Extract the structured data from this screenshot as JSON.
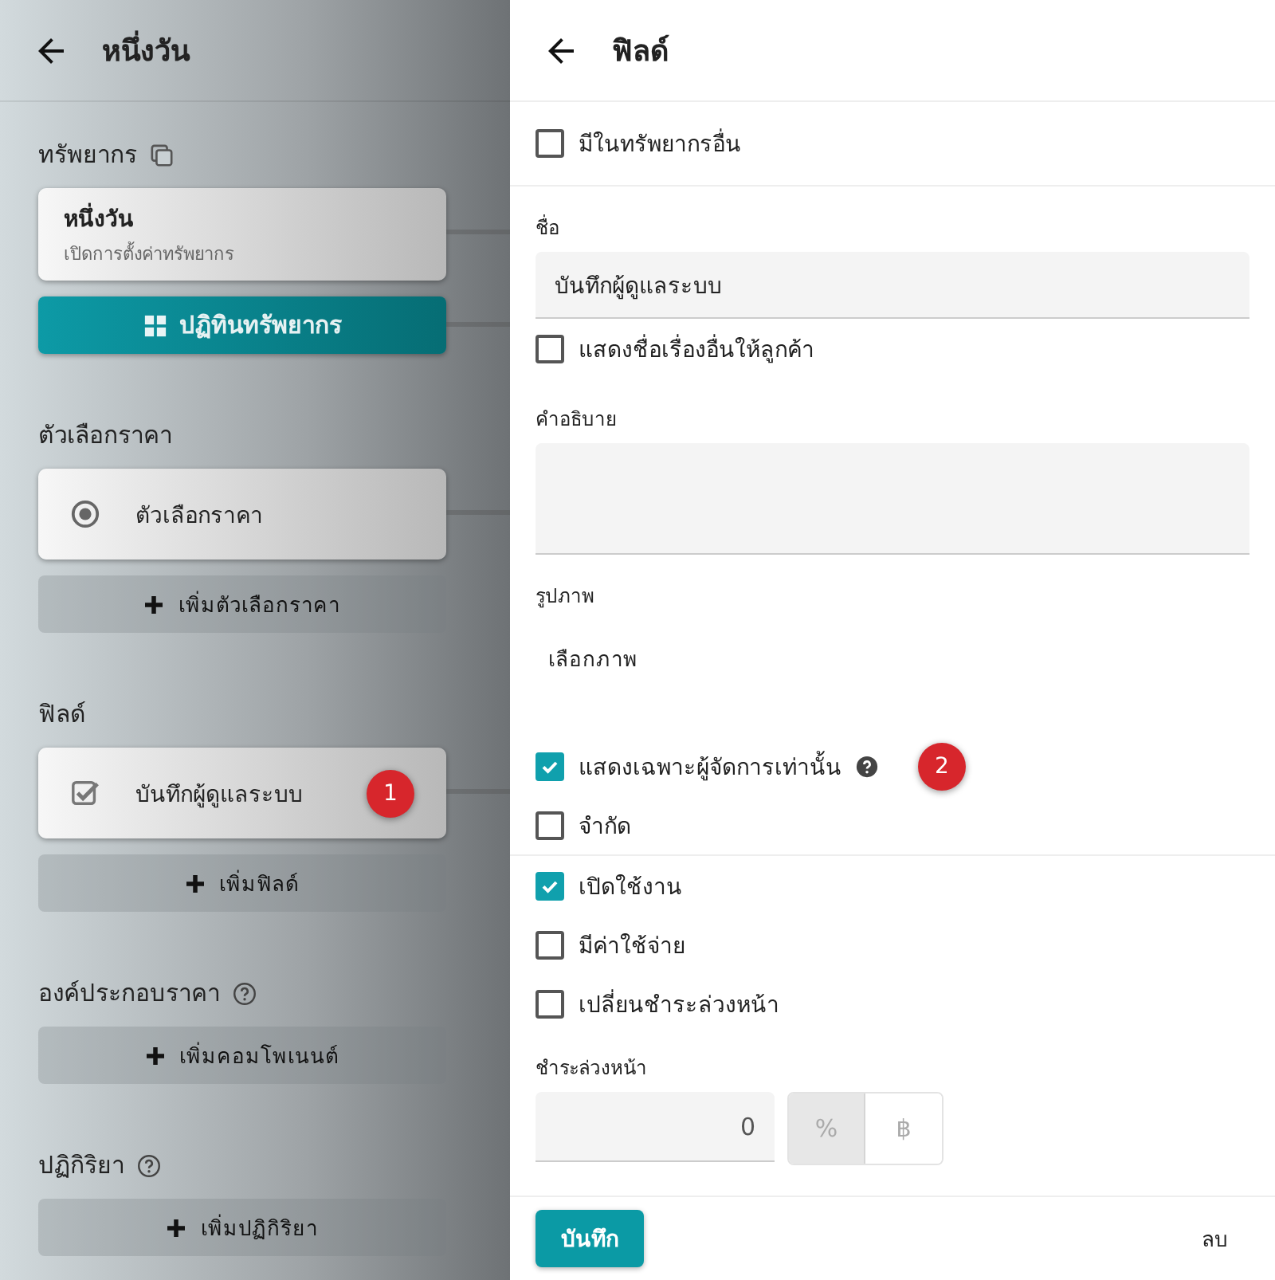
{
  "left": {
    "title": "หนึ่งวัน",
    "sections": [
      {
        "title": "ทรัพยากร",
        "copy": true,
        "card": {
          "kind": "resource",
          "title": "หนึ่งวัน",
          "subtitle": "เปิดการตั้งค่าทรัพยากร"
        },
        "action": {
          "kind": "primary",
          "label": "ปฏิทินทรัพยากร"
        }
      },
      {
        "title": "ตัวเลือกราคา",
        "card": {
          "kind": "radio",
          "title": "ตัวเลือกราคา"
        },
        "action": {
          "kind": "add",
          "label": "เพิ่มตัวเลือกราคา"
        }
      },
      {
        "title": "ฟิลด์",
        "card": {
          "kind": "checkbox",
          "title": "บันทึกผู้ดูแลระบบ",
          "badge": "1"
        },
        "action": {
          "kind": "add",
          "label": "เพิ่มฟิลด์"
        }
      },
      {
        "title": "องค์ประกอบราคา",
        "help": true,
        "action": {
          "kind": "add",
          "label": "เพิ่มคอมโพเนนต์"
        }
      },
      {
        "title": "ปฏิกิริยา",
        "help": true,
        "action": {
          "kind": "add",
          "label": "เพิ่มปฏิกิริยา"
        }
      }
    ]
  },
  "right": {
    "title": "ฟิลด์",
    "items": [
      {
        "kind": "checkbox",
        "label": "มีในทรัพยากรอื่น",
        "checked": false
      },
      {
        "kind": "divider"
      },
      {
        "kind": "text",
        "label": "ชื่อ",
        "value": "บันทึกผู้ดูแลระบบ"
      },
      {
        "kind": "checkbox",
        "label": "แสดงชื่อเรื่องอื่นให้ลูกค้า",
        "checked": false
      },
      {
        "kind": "textarea",
        "label": "คำอธิบาย"
      },
      {
        "kind": "image",
        "label": "รูปภาพ",
        "button": "เลือกภาพ"
      },
      {
        "kind": "checkbox",
        "label": "แสดงเฉพาะผู้จัดการเท่านั้น",
        "checked": true,
        "help": true,
        "badge": "2"
      },
      {
        "kind": "checkbox",
        "label": "จำกัด",
        "checked": false
      },
      {
        "kind": "divider"
      },
      {
        "kind": "checkbox",
        "label": "เปิดใช้งาน",
        "checked": true
      },
      {
        "kind": "checkbox",
        "label": "มีค่าใช้จ่าย",
        "checked": false
      },
      {
        "kind": "checkbox",
        "label": "เปลี่ยนชำระล่วงหน้า",
        "checked": false
      },
      {
        "kind": "amount",
        "label": "ชำระล่วงหน้า",
        "value": "0",
        "units": [
          {
            "label": "%",
            "selected": true
          },
          {
            "label": "฿",
            "selected": false
          }
        ]
      }
    ],
    "save": "บันทึก",
    "delete": "ลบ"
  }
}
